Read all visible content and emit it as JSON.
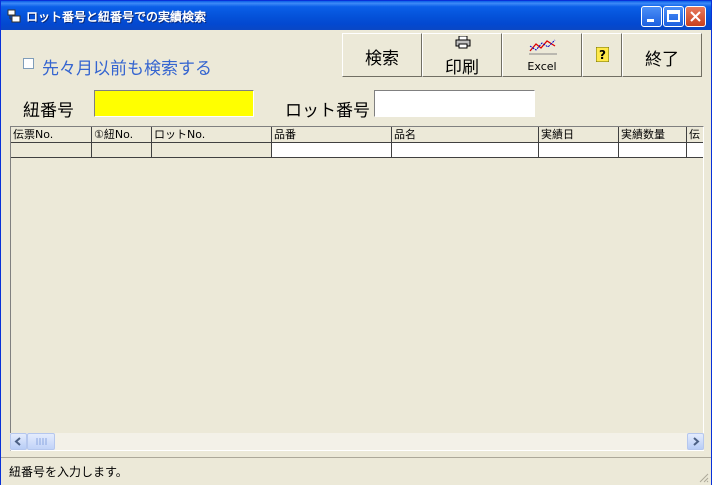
{
  "window": {
    "title": "ロット番号と紐番号での実績検索"
  },
  "options": {
    "include_older_label": "先々月以前も検索する",
    "include_older_checked": false
  },
  "toolbar": {
    "search_label": "検索",
    "print_label": "印刷",
    "excel_label": "Excel",
    "exit_label": "終了"
  },
  "filters": {
    "himo_label": "紐番号",
    "himo_value": "",
    "lot_label": "ロット番号",
    "lot_value": ""
  },
  "grid": {
    "columns": [
      "伝票No.",
      "①紐No.",
      "ロットNo.",
      "品番",
      "品名",
      "実績日",
      "実績数量",
      "伝"
    ],
    "rows": []
  },
  "status": {
    "message": "紐番号を入力します。"
  },
  "colors": {
    "required_field": "#ffff00",
    "label_blue": "#3565d0"
  }
}
